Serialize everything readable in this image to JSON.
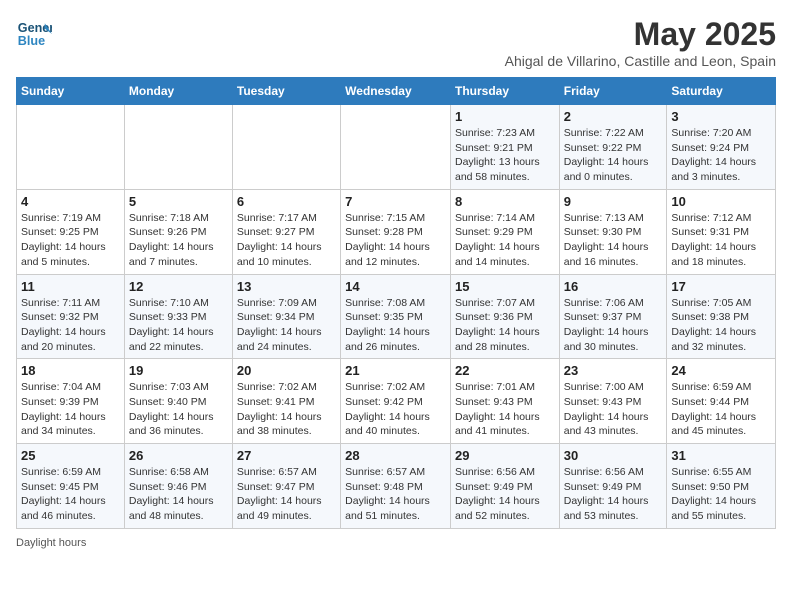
{
  "header": {
    "logo_line1": "General",
    "logo_line2": "Blue",
    "month_title": "May 2025",
    "subtitle": "Ahigal de Villarino, Castille and Leon, Spain"
  },
  "days_of_week": [
    "Sunday",
    "Monday",
    "Tuesday",
    "Wednesday",
    "Thursday",
    "Friday",
    "Saturday"
  ],
  "footer": {
    "note": "Daylight hours"
  },
  "weeks": [
    {
      "days": [
        {
          "num": "",
          "info": ""
        },
        {
          "num": "",
          "info": ""
        },
        {
          "num": "",
          "info": ""
        },
        {
          "num": "",
          "info": ""
        },
        {
          "num": "1",
          "info": "Sunrise: 7:23 AM\nSunset: 9:21 PM\nDaylight: 13 hours\nand 58 minutes."
        },
        {
          "num": "2",
          "info": "Sunrise: 7:22 AM\nSunset: 9:22 PM\nDaylight: 14 hours\nand 0 minutes."
        },
        {
          "num": "3",
          "info": "Sunrise: 7:20 AM\nSunset: 9:24 PM\nDaylight: 14 hours\nand 3 minutes."
        }
      ]
    },
    {
      "days": [
        {
          "num": "4",
          "info": "Sunrise: 7:19 AM\nSunset: 9:25 PM\nDaylight: 14 hours\nand 5 minutes."
        },
        {
          "num": "5",
          "info": "Sunrise: 7:18 AM\nSunset: 9:26 PM\nDaylight: 14 hours\nand 7 minutes."
        },
        {
          "num": "6",
          "info": "Sunrise: 7:17 AM\nSunset: 9:27 PM\nDaylight: 14 hours\nand 10 minutes."
        },
        {
          "num": "7",
          "info": "Sunrise: 7:15 AM\nSunset: 9:28 PM\nDaylight: 14 hours\nand 12 minutes."
        },
        {
          "num": "8",
          "info": "Sunrise: 7:14 AM\nSunset: 9:29 PM\nDaylight: 14 hours\nand 14 minutes."
        },
        {
          "num": "9",
          "info": "Sunrise: 7:13 AM\nSunset: 9:30 PM\nDaylight: 14 hours\nand 16 minutes."
        },
        {
          "num": "10",
          "info": "Sunrise: 7:12 AM\nSunset: 9:31 PM\nDaylight: 14 hours\nand 18 minutes."
        }
      ]
    },
    {
      "days": [
        {
          "num": "11",
          "info": "Sunrise: 7:11 AM\nSunset: 9:32 PM\nDaylight: 14 hours\nand 20 minutes."
        },
        {
          "num": "12",
          "info": "Sunrise: 7:10 AM\nSunset: 9:33 PM\nDaylight: 14 hours\nand 22 minutes."
        },
        {
          "num": "13",
          "info": "Sunrise: 7:09 AM\nSunset: 9:34 PM\nDaylight: 14 hours\nand 24 minutes."
        },
        {
          "num": "14",
          "info": "Sunrise: 7:08 AM\nSunset: 9:35 PM\nDaylight: 14 hours\nand 26 minutes."
        },
        {
          "num": "15",
          "info": "Sunrise: 7:07 AM\nSunset: 9:36 PM\nDaylight: 14 hours\nand 28 minutes."
        },
        {
          "num": "16",
          "info": "Sunrise: 7:06 AM\nSunset: 9:37 PM\nDaylight: 14 hours\nand 30 minutes."
        },
        {
          "num": "17",
          "info": "Sunrise: 7:05 AM\nSunset: 9:38 PM\nDaylight: 14 hours\nand 32 minutes."
        }
      ]
    },
    {
      "days": [
        {
          "num": "18",
          "info": "Sunrise: 7:04 AM\nSunset: 9:39 PM\nDaylight: 14 hours\nand 34 minutes."
        },
        {
          "num": "19",
          "info": "Sunrise: 7:03 AM\nSunset: 9:40 PM\nDaylight: 14 hours\nand 36 minutes."
        },
        {
          "num": "20",
          "info": "Sunrise: 7:02 AM\nSunset: 9:41 PM\nDaylight: 14 hours\nand 38 minutes."
        },
        {
          "num": "21",
          "info": "Sunrise: 7:02 AM\nSunset: 9:42 PM\nDaylight: 14 hours\nand 40 minutes."
        },
        {
          "num": "22",
          "info": "Sunrise: 7:01 AM\nSunset: 9:43 PM\nDaylight: 14 hours\nand 41 minutes."
        },
        {
          "num": "23",
          "info": "Sunrise: 7:00 AM\nSunset: 9:43 PM\nDaylight: 14 hours\nand 43 minutes."
        },
        {
          "num": "24",
          "info": "Sunrise: 6:59 AM\nSunset: 9:44 PM\nDaylight: 14 hours\nand 45 minutes."
        }
      ]
    },
    {
      "days": [
        {
          "num": "25",
          "info": "Sunrise: 6:59 AM\nSunset: 9:45 PM\nDaylight: 14 hours\nand 46 minutes."
        },
        {
          "num": "26",
          "info": "Sunrise: 6:58 AM\nSunset: 9:46 PM\nDaylight: 14 hours\nand 48 minutes."
        },
        {
          "num": "27",
          "info": "Sunrise: 6:57 AM\nSunset: 9:47 PM\nDaylight: 14 hours\nand 49 minutes."
        },
        {
          "num": "28",
          "info": "Sunrise: 6:57 AM\nSunset: 9:48 PM\nDaylight: 14 hours\nand 51 minutes."
        },
        {
          "num": "29",
          "info": "Sunrise: 6:56 AM\nSunset: 9:49 PM\nDaylight: 14 hours\nand 52 minutes."
        },
        {
          "num": "30",
          "info": "Sunrise: 6:56 AM\nSunset: 9:49 PM\nDaylight: 14 hours\nand 53 minutes."
        },
        {
          "num": "31",
          "info": "Sunrise: 6:55 AM\nSunset: 9:50 PM\nDaylight: 14 hours\nand 55 minutes."
        }
      ]
    }
  ]
}
